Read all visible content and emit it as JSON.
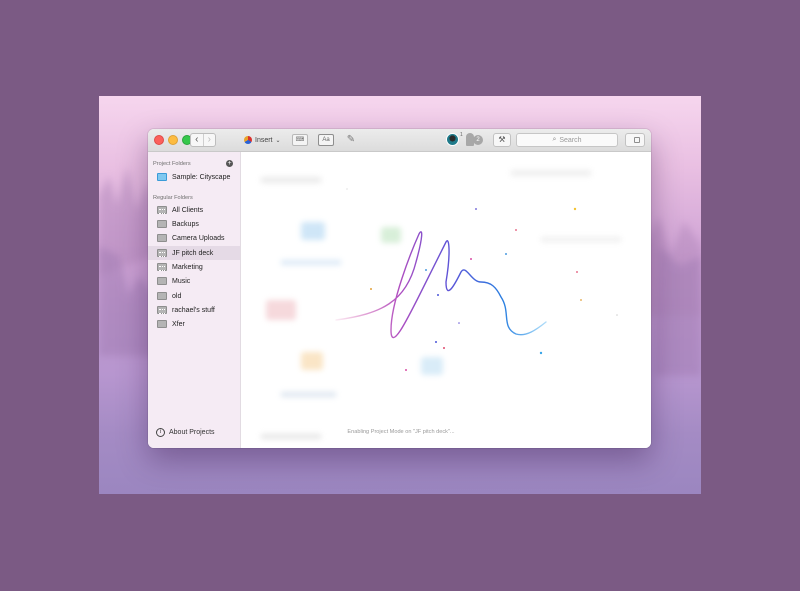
{
  "sidebar": {
    "project_folders_header": "Project Folders",
    "project_folders": [
      {
        "label": "Sample: Cityscape",
        "icon": "folder-blue-icon"
      }
    ],
    "regular_folders_header": "Regular Folders",
    "regular_folders": [
      {
        "label": "All Clients",
        "icon": "shared-folder-icon"
      },
      {
        "label": "Backups",
        "icon": "folder-icon"
      },
      {
        "label": "Camera Uploads",
        "icon": "folder-icon"
      },
      {
        "label": "JF pitch deck",
        "icon": "shared-folder-icon",
        "selected": true
      },
      {
        "label": "Marketing",
        "icon": "shared-folder-icon"
      },
      {
        "label": "Music",
        "icon": "folder-icon"
      },
      {
        "label": "old",
        "icon": "folder-icon"
      },
      {
        "label": "rachael's stuff",
        "icon": "shared-folder-icon"
      },
      {
        "label": "Xfer",
        "icon": "folder-icon"
      }
    ],
    "about_label": "About Projects"
  },
  "toolbar": {
    "insert_label": "Insert",
    "aa_label": "Aa",
    "avatar_count": "1",
    "notification_count": "2",
    "search_placeholder": "Search"
  },
  "content": {
    "status_message": "Enabling Project Mode on \"JF pitch deck\"..."
  }
}
